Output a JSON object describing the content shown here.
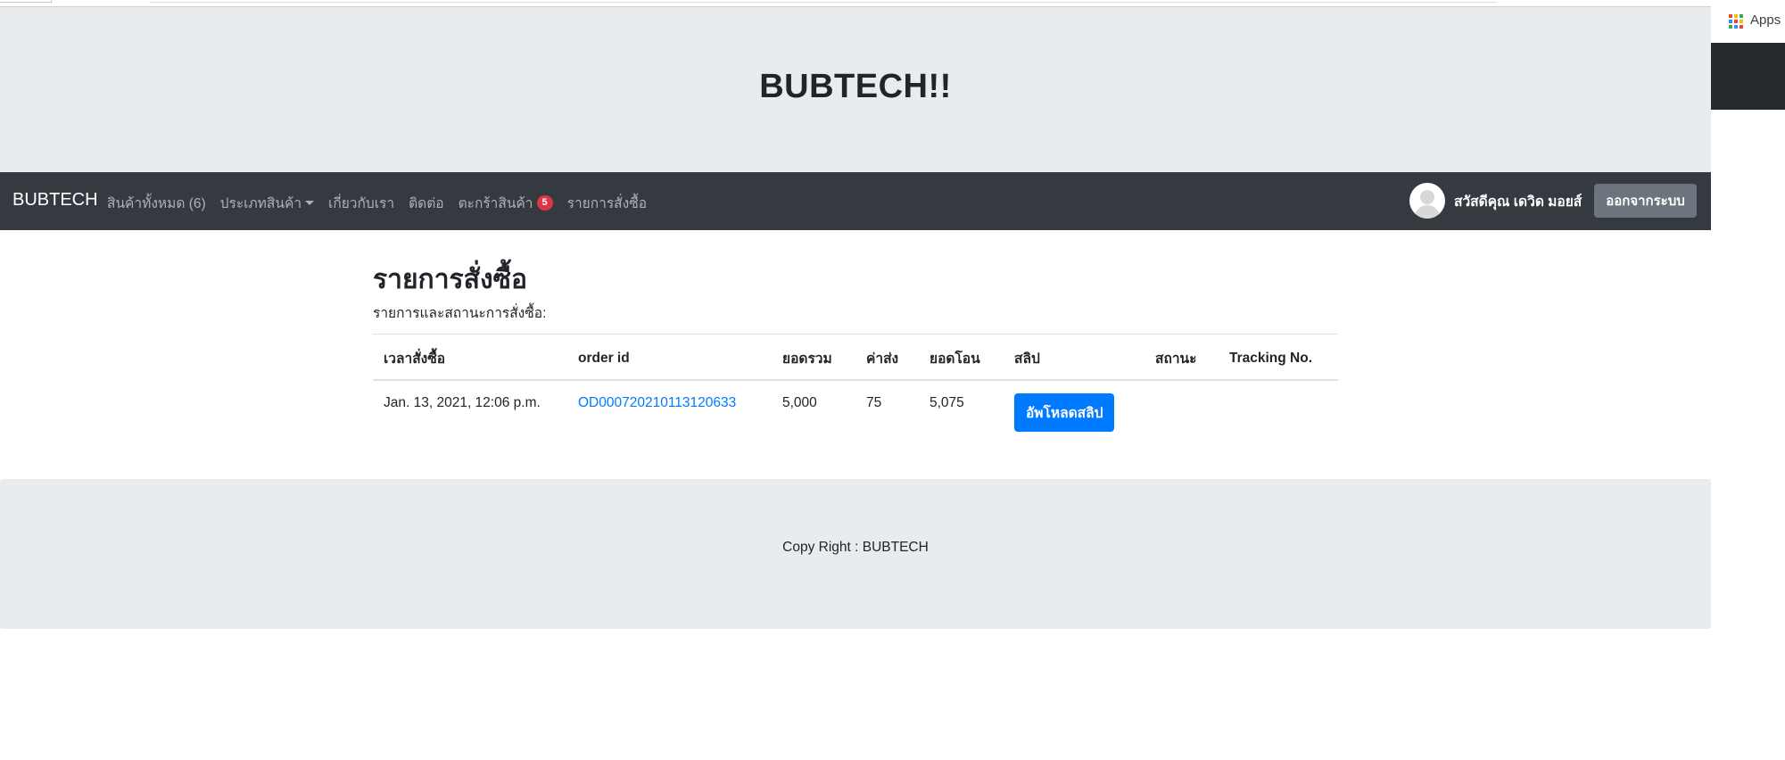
{
  "browser": {
    "apps_label": "Apps",
    "apps_icon_colors": [
      "#ea4335",
      "#fbbc04",
      "#34a853",
      "#4285f4",
      "#ea4335",
      "#fbbc04",
      "#34a853",
      "#4285f4",
      "#ea4335"
    ]
  },
  "header": {
    "site_title": "BUBTECH!!"
  },
  "navbar": {
    "brand": "BUBTECH",
    "links": {
      "all_products": "สินค้าทั้งหมด (6)",
      "categories": "ประเภทสินค้า",
      "about": "เกี่ยวกับเรา",
      "contact": "ติดต่อ",
      "cart": "ตะกร้าสินค้า",
      "cart_count": "5",
      "orders": "รายการสั่งซื้อ"
    },
    "greeting": "สวัสดีคุณ  เดวิด มอยส์",
    "logout_label": "ออกจากระบบ"
  },
  "main": {
    "heading": "รายการสั่งซื้อ",
    "subheading": "รายการและสถานะการสั่งซื้อ:",
    "table": {
      "headers": {
        "order_time": "เวลาสั่งซื้อ",
        "order_id": "order id",
        "total": "ยอดรวม",
        "shipping": "ค่าส่ง",
        "transfer": "ยอดโอน",
        "slip": "สลิป",
        "status": "สถานะ",
        "tracking": "Tracking No."
      },
      "rows": [
        {
          "order_time": "Jan. 13, 2021, 12:06 p.m.",
          "order_id": "OD000720210113120633",
          "total": "5,000",
          "shipping": "75",
          "transfer": "5,075",
          "slip_button": "อัพโหลดสลิป",
          "status": "",
          "tracking": ""
        }
      ]
    }
  },
  "footer": {
    "text": "Copy Right : BUBTECH"
  },
  "colors": {
    "navbar_bg": "#343a40",
    "jumbotron_bg": "#e9ecef",
    "primary": "#007bff",
    "badge_red": "#dc3545",
    "secondary": "#6c757d"
  }
}
